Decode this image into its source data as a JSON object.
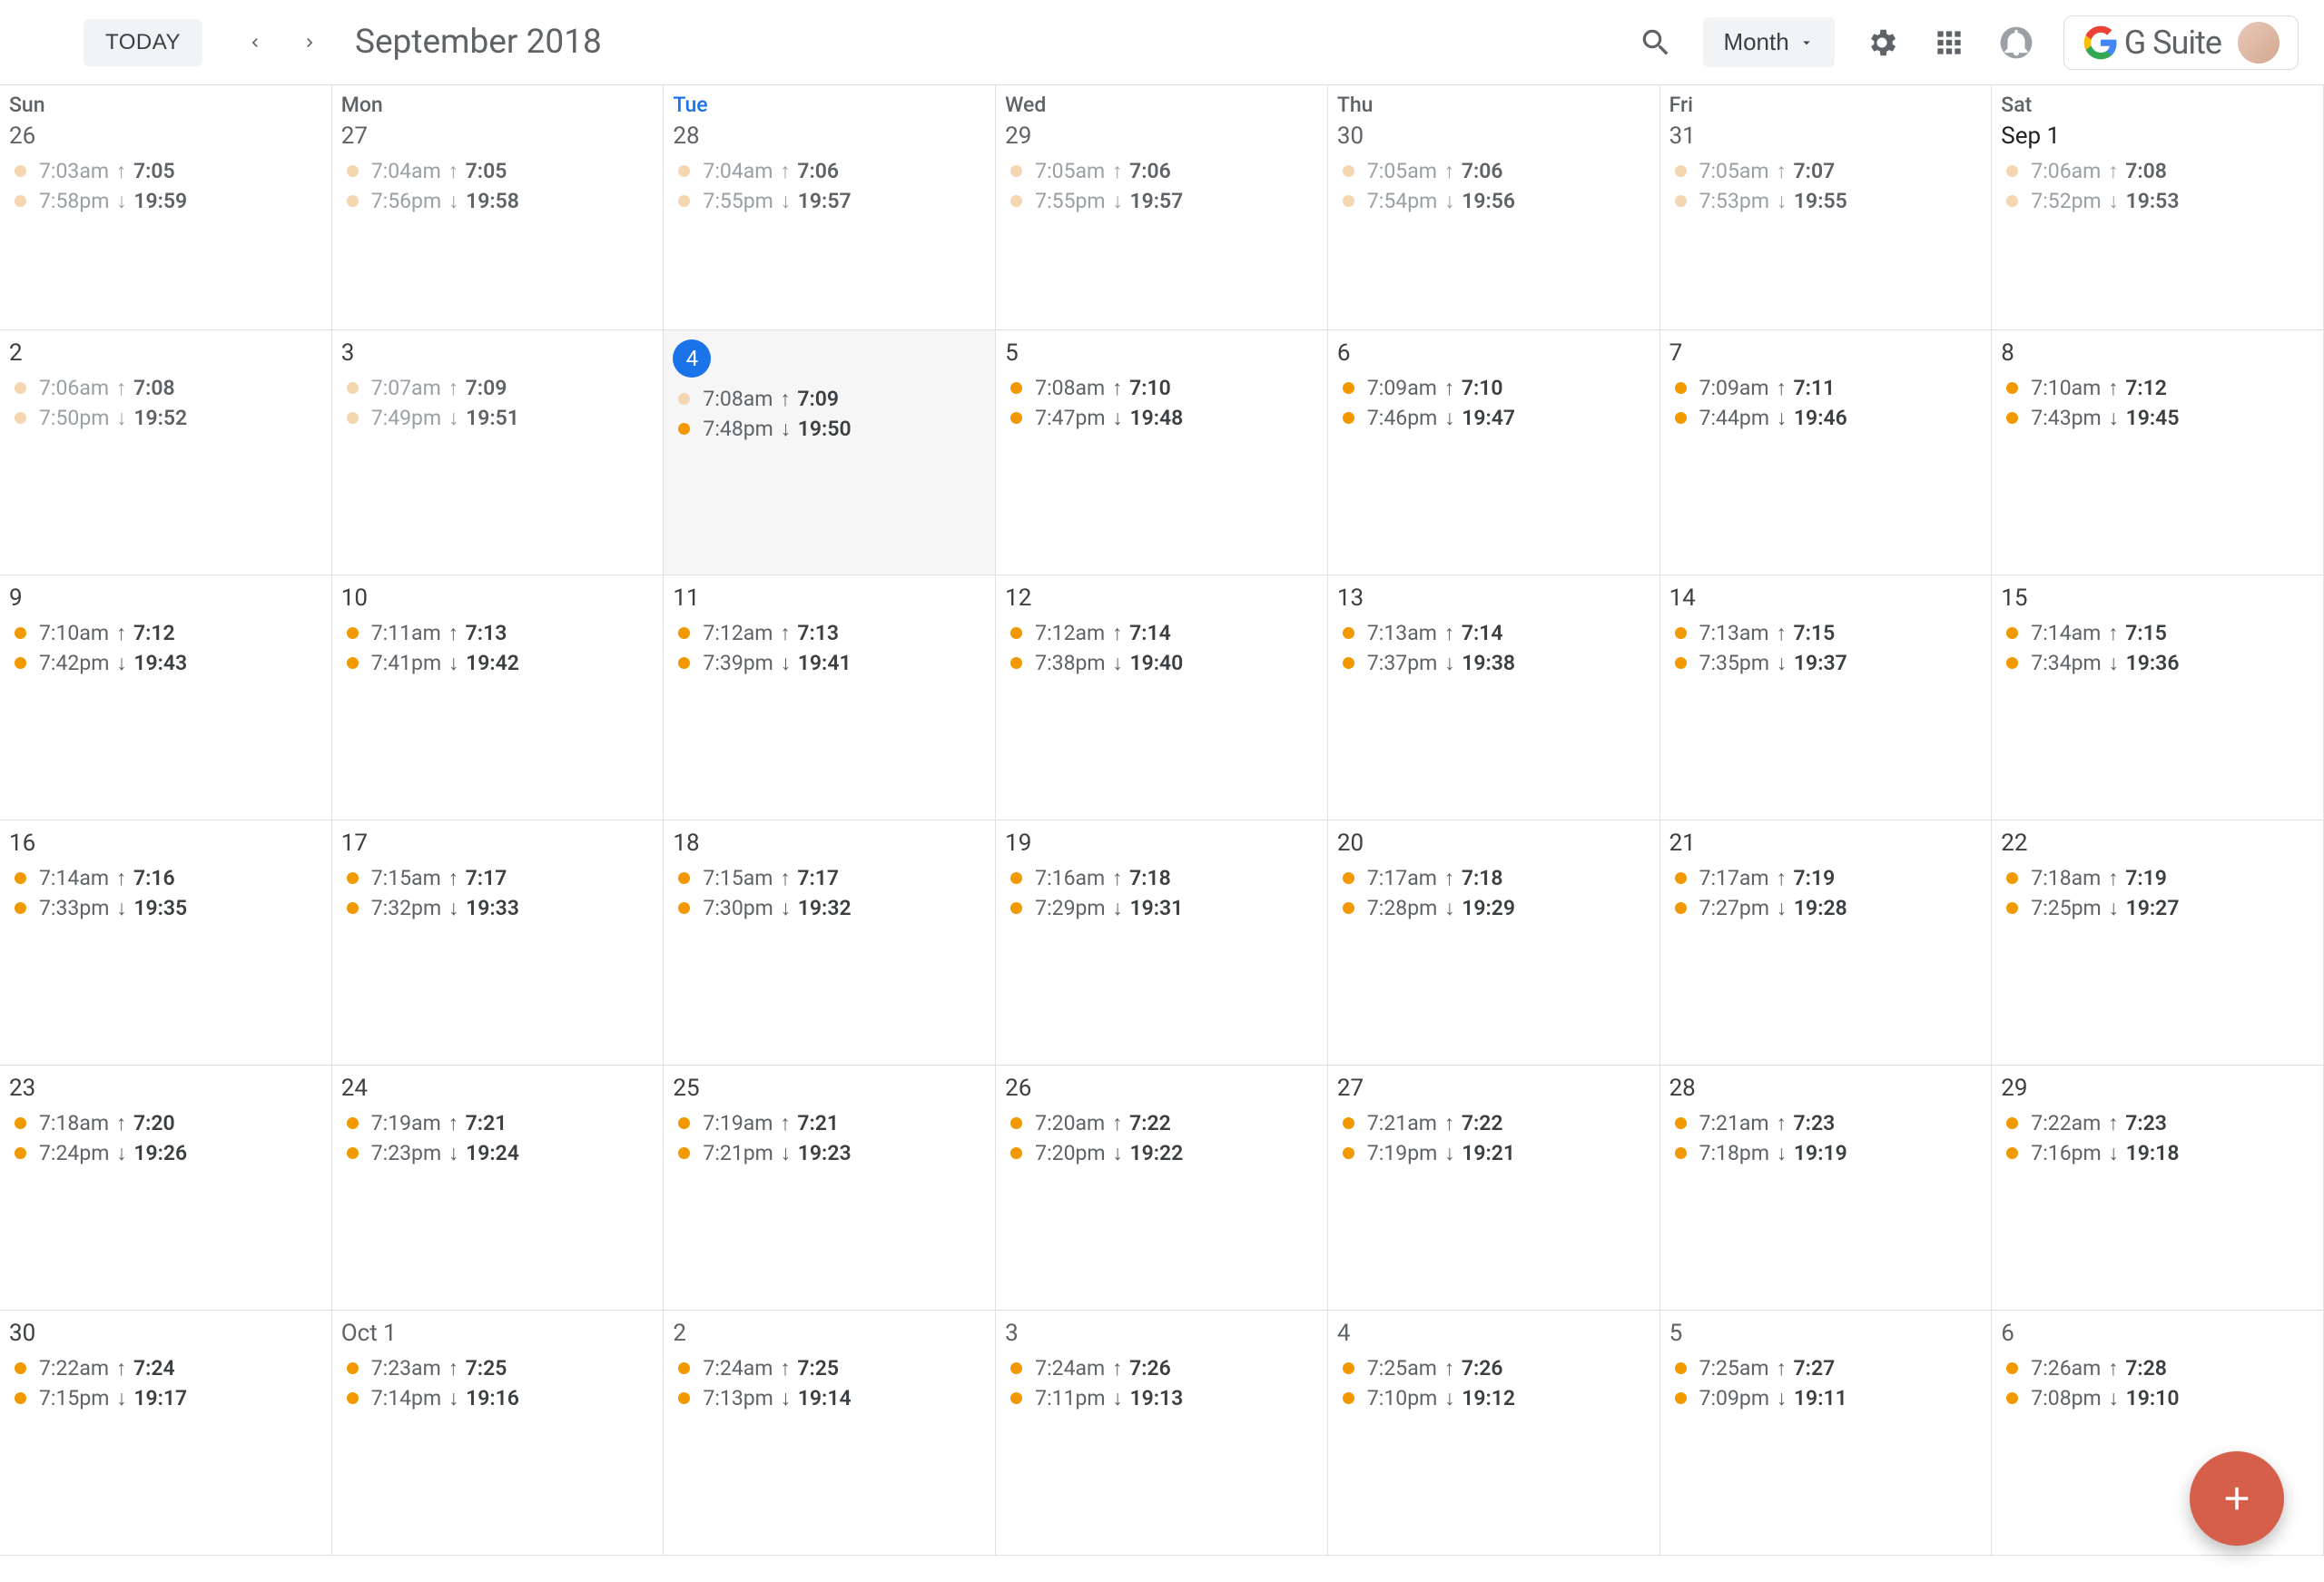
{
  "header": {
    "today_label": "TODAY",
    "title": "September 2018",
    "view_label": "Month",
    "gsuite_label": "G Suite"
  },
  "day_headers": [
    "Sun",
    "Mon",
    "Tue",
    "Wed",
    "Thu",
    "Fri",
    "Sat"
  ],
  "weeks": [
    [
      {
        "num": "26",
        "other": true,
        "faded": true,
        "e1": {
          "t": "7:03am",
          "a": "↑",
          "v": "7:05"
        },
        "e2": {
          "t": "7:58pm",
          "a": "↓",
          "v": "19:59"
        }
      },
      {
        "num": "27",
        "other": true,
        "faded": true,
        "e1": {
          "t": "7:04am",
          "a": "↑",
          "v": "7:05"
        },
        "e2": {
          "t": "7:56pm",
          "a": "↓",
          "v": "19:58"
        }
      },
      {
        "num": "28",
        "other": true,
        "faded": true,
        "header_hl": true,
        "e1": {
          "t": "7:04am",
          "a": "↑",
          "v": "7:06"
        },
        "e2": {
          "t": "7:55pm",
          "a": "↓",
          "v": "19:57"
        }
      },
      {
        "num": "29",
        "other": true,
        "faded": true,
        "e1": {
          "t": "7:05am",
          "a": "↑",
          "v": "7:06"
        },
        "e2": {
          "t": "7:55pm",
          "a": "↓",
          "v": "19:57"
        }
      },
      {
        "num": "30",
        "other": true,
        "faded": true,
        "e1": {
          "t": "7:05am",
          "a": "↑",
          "v": "7:06"
        },
        "e2": {
          "t": "7:54pm",
          "a": "↓",
          "v": "19:56"
        }
      },
      {
        "num": "31",
        "other": true,
        "faded": true,
        "e1": {
          "t": "7:05am",
          "a": "↑",
          "v": "7:07"
        },
        "e2": {
          "t": "7:53pm",
          "a": "↓",
          "v": "19:55"
        }
      },
      {
        "num": "Sep 1",
        "black": true,
        "faded": true,
        "e1": {
          "t": "7:06am",
          "a": "↑",
          "v": "7:08"
        },
        "e2": {
          "t": "7:52pm",
          "a": "↓",
          "v": "19:53"
        }
      }
    ],
    [
      {
        "num": "2",
        "faded": true,
        "e1": {
          "t": "7:06am",
          "a": "↑",
          "v": "7:08"
        },
        "e2": {
          "t": "7:50pm",
          "a": "↓",
          "v": "19:52"
        }
      },
      {
        "num": "3",
        "faded": true,
        "e1": {
          "t": "7:07am",
          "a": "↑",
          "v": "7:09"
        },
        "e2": {
          "t": "7:49pm",
          "a": "↓",
          "v": "19:51"
        }
      },
      {
        "num": "4",
        "today": true,
        "faded": false,
        "today_bg": true,
        "e1": {
          "t": "7:08am",
          "a": "↑",
          "v": "7:09",
          "faded_dot": true
        },
        "e2": {
          "t": "7:48pm",
          "a": "↓",
          "v": "19:50"
        }
      },
      {
        "num": "5",
        "faded": false,
        "e1": {
          "t": "7:08am",
          "a": "↑",
          "v": "7:10"
        },
        "e2": {
          "t": "7:47pm",
          "a": "↓",
          "v": "19:48"
        }
      },
      {
        "num": "6",
        "faded": false,
        "e1": {
          "t": "7:09am",
          "a": "↑",
          "v": "7:10"
        },
        "e2": {
          "t": "7:46pm",
          "a": "↓",
          "v": "19:47"
        }
      },
      {
        "num": "7",
        "faded": false,
        "e1": {
          "t": "7:09am",
          "a": "↑",
          "v": "7:11"
        },
        "e2": {
          "t": "7:44pm",
          "a": "↓",
          "v": "19:46"
        }
      },
      {
        "num": "8",
        "faded": false,
        "e1": {
          "t": "7:10am",
          "a": "↑",
          "v": "7:12"
        },
        "e2": {
          "t": "7:43pm",
          "a": "↓",
          "v": "19:45"
        }
      }
    ],
    [
      {
        "num": "9",
        "faded": false,
        "e1": {
          "t": "7:10am",
          "a": "↑",
          "v": "7:12"
        },
        "e2": {
          "t": "7:42pm",
          "a": "↓",
          "v": "19:43"
        }
      },
      {
        "num": "10",
        "faded": false,
        "e1": {
          "t": "7:11am",
          "a": "↑",
          "v": "7:13"
        },
        "e2": {
          "t": "7:41pm",
          "a": "↓",
          "v": "19:42"
        }
      },
      {
        "num": "11",
        "faded": false,
        "e1": {
          "t": "7:12am",
          "a": "↑",
          "v": "7:13"
        },
        "e2": {
          "t": "7:39pm",
          "a": "↓",
          "v": "19:41"
        }
      },
      {
        "num": "12",
        "faded": false,
        "e1": {
          "t": "7:12am",
          "a": "↑",
          "v": "7:14"
        },
        "e2": {
          "t": "7:38pm",
          "a": "↓",
          "v": "19:40"
        }
      },
      {
        "num": "13",
        "faded": false,
        "e1": {
          "t": "7:13am",
          "a": "↑",
          "v": "7:14"
        },
        "e2": {
          "t": "7:37pm",
          "a": "↓",
          "v": "19:38"
        }
      },
      {
        "num": "14",
        "faded": false,
        "e1": {
          "t": "7:13am",
          "a": "↑",
          "v": "7:15"
        },
        "e2": {
          "t": "7:35pm",
          "a": "↓",
          "v": "19:37"
        }
      },
      {
        "num": "15",
        "faded": false,
        "e1": {
          "t": "7:14am",
          "a": "↑",
          "v": "7:15"
        },
        "e2": {
          "t": "7:34pm",
          "a": "↓",
          "v": "19:36"
        }
      }
    ],
    [
      {
        "num": "16",
        "faded": false,
        "e1": {
          "t": "7:14am",
          "a": "↑",
          "v": "7:16"
        },
        "e2": {
          "t": "7:33pm",
          "a": "↓",
          "v": "19:35"
        }
      },
      {
        "num": "17",
        "faded": false,
        "e1": {
          "t": "7:15am",
          "a": "↑",
          "v": "7:17"
        },
        "e2": {
          "t": "7:32pm",
          "a": "↓",
          "v": "19:33"
        }
      },
      {
        "num": "18",
        "faded": false,
        "e1": {
          "t": "7:15am",
          "a": "↑",
          "v": "7:17"
        },
        "e2": {
          "t": "7:30pm",
          "a": "↓",
          "v": "19:32"
        }
      },
      {
        "num": "19",
        "faded": false,
        "e1": {
          "t": "7:16am",
          "a": "↑",
          "v": "7:18"
        },
        "e2": {
          "t": "7:29pm",
          "a": "↓",
          "v": "19:31"
        }
      },
      {
        "num": "20",
        "faded": false,
        "e1": {
          "t": "7:17am",
          "a": "↑",
          "v": "7:18"
        },
        "e2": {
          "t": "7:28pm",
          "a": "↓",
          "v": "19:29"
        }
      },
      {
        "num": "21",
        "faded": false,
        "e1": {
          "t": "7:17am",
          "a": "↑",
          "v": "7:19"
        },
        "e2": {
          "t": "7:27pm",
          "a": "↓",
          "v": "19:28"
        }
      },
      {
        "num": "22",
        "faded": false,
        "e1": {
          "t": "7:18am",
          "a": "↑",
          "v": "7:19"
        },
        "e2": {
          "t": "7:25pm",
          "a": "↓",
          "v": "19:27"
        }
      }
    ],
    [
      {
        "num": "23",
        "faded": false,
        "e1": {
          "t": "7:18am",
          "a": "↑",
          "v": "7:20"
        },
        "e2": {
          "t": "7:24pm",
          "a": "↓",
          "v": "19:26"
        }
      },
      {
        "num": "24",
        "faded": false,
        "e1": {
          "t": "7:19am",
          "a": "↑",
          "v": "7:21"
        },
        "e2": {
          "t": "7:23pm",
          "a": "↓",
          "v": "19:24"
        }
      },
      {
        "num": "25",
        "faded": false,
        "e1": {
          "t": "7:19am",
          "a": "↑",
          "v": "7:21"
        },
        "e2": {
          "t": "7:21pm",
          "a": "↓",
          "v": "19:23"
        }
      },
      {
        "num": "26",
        "faded": false,
        "e1": {
          "t": "7:20am",
          "a": "↑",
          "v": "7:22"
        },
        "e2": {
          "t": "7:20pm",
          "a": "↓",
          "v": "19:22"
        }
      },
      {
        "num": "27",
        "faded": false,
        "e1": {
          "t": "7:21am",
          "a": "↑",
          "v": "7:22"
        },
        "e2": {
          "t": "7:19pm",
          "a": "↓",
          "v": "19:21"
        }
      },
      {
        "num": "28",
        "faded": false,
        "e1": {
          "t": "7:21am",
          "a": "↑",
          "v": "7:23"
        },
        "e2": {
          "t": "7:18pm",
          "a": "↓",
          "v": "19:19"
        }
      },
      {
        "num": "29",
        "faded": false,
        "e1": {
          "t": "7:22am",
          "a": "↑",
          "v": "7:23"
        },
        "e2": {
          "t": "7:16pm",
          "a": "↓",
          "v": "19:18"
        }
      }
    ],
    [
      {
        "num": "30",
        "faded": false,
        "e1": {
          "t": "7:22am",
          "a": "↑",
          "v": "7:24"
        },
        "e2": {
          "t": "7:15pm",
          "a": "↓",
          "v": "19:17"
        }
      },
      {
        "num": "Oct 1",
        "other": true,
        "faded": false,
        "e1": {
          "t": "7:23am",
          "a": "↑",
          "v": "7:25"
        },
        "e2": {
          "t": "7:14pm",
          "a": "↓",
          "v": "19:16"
        }
      },
      {
        "num": "2",
        "other": true,
        "faded": false,
        "e1": {
          "t": "7:24am",
          "a": "↑",
          "v": "7:25"
        },
        "e2": {
          "t": "7:13pm",
          "a": "↓",
          "v": "19:14"
        }
      },
      {
        "num": "3",
        "other": true,
        "faded": false,
        "e1": {
          "t": "7:24am",
          "a": "↑",
          "v": "7:26"
        },
        "e2": {
          "t": "7:11pm",
          "a": "↓",
          "v": "19:13"
        }
      },
      {
        "num": "4",
        "other": true,
        "faded": false,
        "e1": {
          "t": "7:25am",
          "a": "↑",
          "v": "7:26"
        },
        "e2": {
          "t": "7:10pm",
          "a": "↓",
          "v": "19:12"
        }
      },
      {
        "num": "5",
        "other": true,
        "faded": false,
        "e1": {
          "t": "7:25am",
          "a": "↑",
          "v": "7:27"
        },
        "e2": {
          "t": "7:09pm",
          "a": "↓",
          "v": "19:11"
        }
      },
      {
        "num": "6",
        "other": true,
        "faded": false,
        "e1": {
          "t": "7:26am",
          "a": "↑",
          "v": "7:28"
        },
        "e2": {
          "t": "7:08pm",
          "a": "↓",
          "v": "19:10"
        }
      }
    ]
  ]
}
